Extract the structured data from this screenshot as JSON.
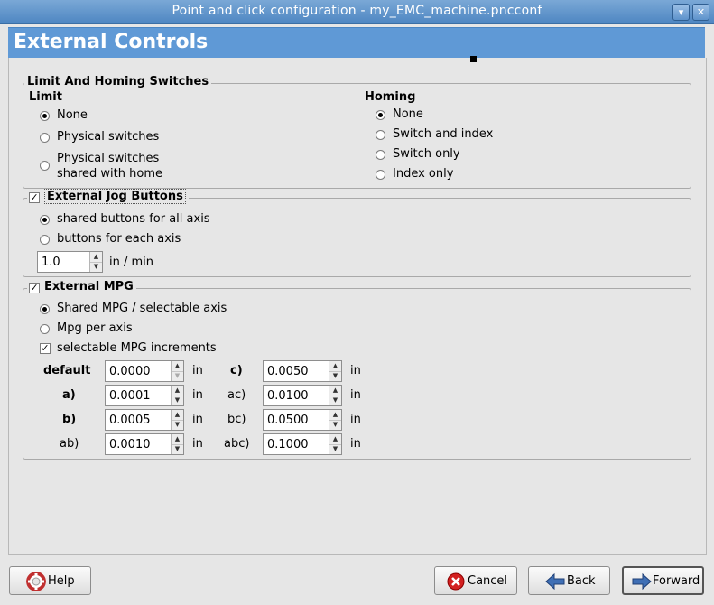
{
  "window": {
    "title": "Point and click configuration - my_EMC_machine.pncconf",
    "btn_min": "▾",
    "btn_close": "✕"
  },
  "header": {
    "title": "External Controls"
  },
  "limit_homing": {
    "legend": "Limit And Homing Switches",
    "limit": {
      "heading": "Limit",
      "options": [
        "None",
        "Physical switches",
        "Physical switches",
        "shared with home"
      ],
      "selected": "None"
    },
    "homing": {
      "heading": "Homing",
      "options": [
        "None",
        "Switch and index",
        "Switch only",
        "Index only"
      ],
      "selected": "None"
    }
  },
  "jog": {
    "legend": "External Jog Buttons",
    "checked": true,
    "options": [
      "shared buttons for all axis",
      "buttons for each axis"
    ],
    "selected": "shared buttons for all axis",
    "speed_value": "1.0",
    "speed_unit": "in / min"
  },
  "mpg": {
    "legend": "External MPG",
    "checked": true,
    "options": [
      "Shared MPG / selectable axis",
      "Mpg per axis"
    ],
    "selected": "Shared MPG / selectable axis",
    "increments_label": "selectable MPG increments",
    "increments_checked": true,
    "unit": "in",
    "left": [
      {
        "label": "default",
        "value": "0.0000"
      },
      {
        "label": "a)",
        "value": "0.0001"
      },
      {
        "label": "b)",
        "value": "0.0005"
      },
      {
        "label": "ab)",
        "value": "0.0010"
      }
    ],
    "right": [
      {
        "label": "c)",
        "value": "0.0050"
      },
      {
        "label": "ac)",
        "value": "0.0100"
      },
      {
        "label": "bc)",
        "value": "0.0500"
      },
      {
        "label": "abc)",
        "value": "0.1000"
      }
    ]
  },
  "buttons": {
    "help": "Help",
    "cancel": "Cancel",
    "back": "Back",
    "forward": "Forward"
  }
}
